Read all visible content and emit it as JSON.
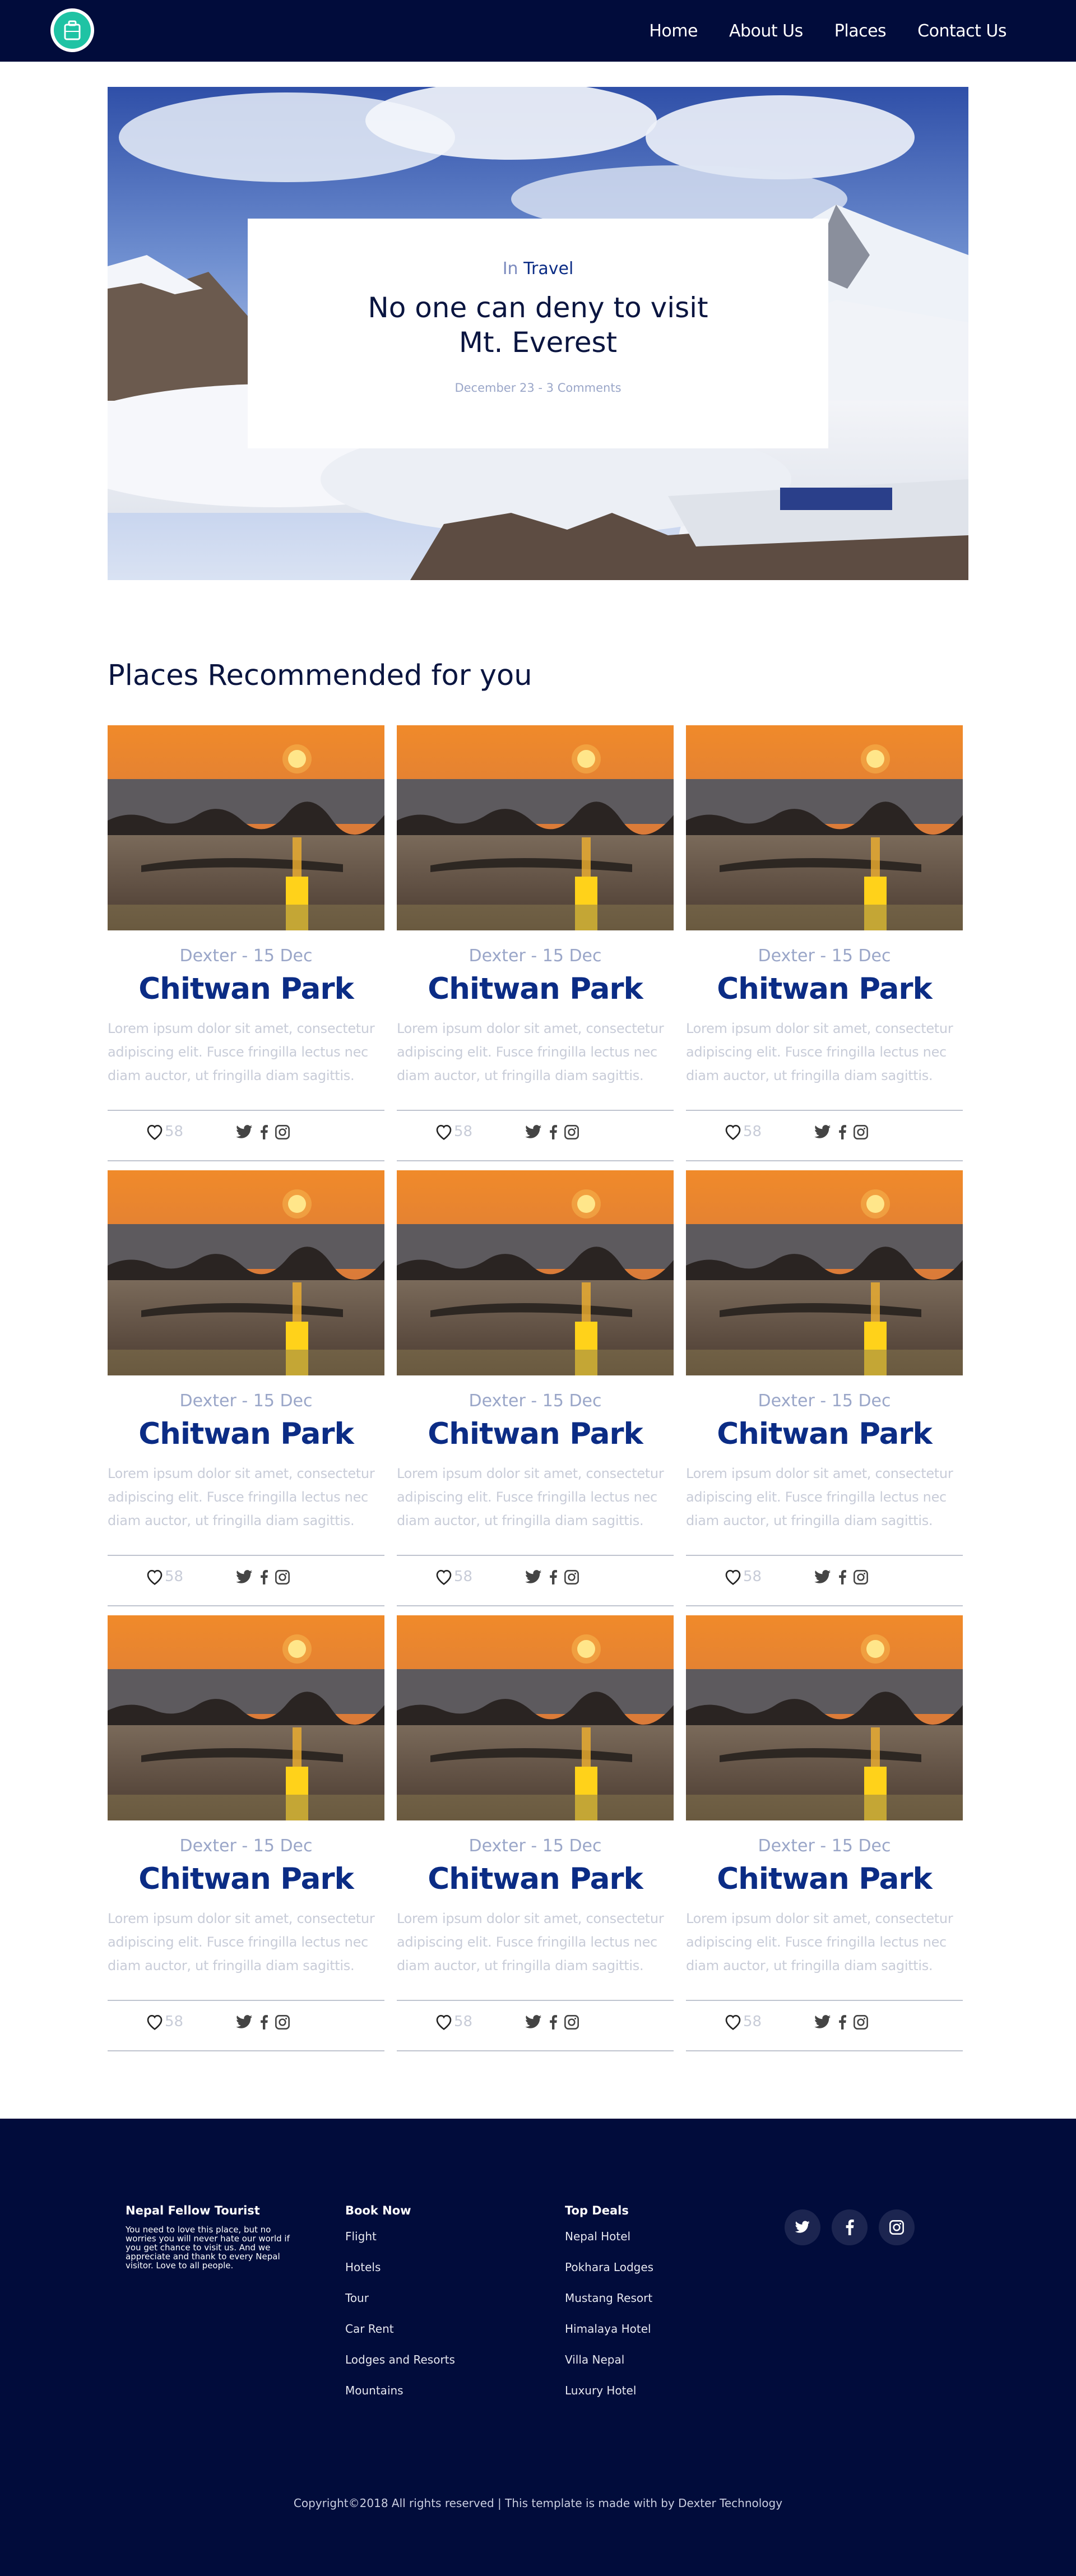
{
  "nav": {
    "links": [
      "Home",
      "About Us",
      "Places",
      "Contact Us"
    ]
  },
  "hero": {
    "category_prefix": "In",
    "category": "Travel",
    "title_line1": "No one can deny to visit",
    "title_line2": "Mt. Everest",
    "meta": "December 23 - 3 Comments"
  },
  "section": {
    "title": "Places Recommended for you"
  },
  "cards": [
    {
      "meta": "Dexter - 15 Dec",
      "title": "Chitwan Park",
      "desc": "Lorem ipsum dolor sit amet, consectetur adipiscing elit. Fusce fringilla lectus nec diam auctor, ut fringilla diam sagittis.",
      "likes": "58"
    },
    {
      "meta": "Dexter - 15 Dec",
      "title": "Chitwan Park",
      "desc": "Lorem ipsum dolor sit amet, consectetur adipiscing elit. Fusce fringilla lectus nec diam auctor, ut fringilla diam sagittis.",
      "likes": "58"
    },
    {
      "meta": "Dexter - 15 Dec",
      "title": "Chitwan Park",
      "desc": "Lorem ipsum dolor sit amet, consectetur adipiscing elit. Fusce fringilla lectus nec diam auctor, ut fringilla diam sagittis.",
      "likes": "58"
    },
    {
      "meta": "Dexter - 15 Dec",
      "title": "Chitwan Park",
      "desc": "Lorem ipsum dolor sit amet, consectetur adipiscing elit. Fusce fringilla lectus nec diam auctor, ut fringilla diam sagittis.",
      "likes": "58"
    },
    {
      "meta": "Dexter - 15 Dec",
      "title": "Chitwan Park",
      "desc": "Lorem ipsum dolor sit amet, consectetur adipiscing elit. Fusce fringilla lectus nec diam auctor, ut fringilla diam sagittis.",
      "likes": "58"
    },
    {
      "meta": "Dexter - 15 Dec",
      "title": "Chitwan Park",
      "desc": "Lorem ipsum dolor sit amet, consectetur adipiscing elit. Fusce fringilla lectus nec diam auctor, ut fringilla diam sagittis.",
      "likes": "58"
    },
    {
      "meta": "Dexter - 15 Dec",
      "title": "Chitwan Park",
      "desc": "Lorem ipsum dolor sit amet, consectetur adipiscing elit. Fusce fringilla lectus nec diam auctor, ut fringilla diam sagittis.",
      "likes": "58"
    },
    {
      "meta": "Dexter - 15 Dec",
      "title": "Chitwan Park",
      "desc": "Lorem ipsum dolor sit amet, consectetur adipiscing elit. Fusce fringilla lectus nec diam auctor, ut fringilla diam sagittis.",
      "likes": "58"
    },
    {
      "meta": "Dexter - 15 Dec",
      "title": "Chitwan Park",
      "desc": "Lorem ipsum dolor sit amet, consectetur adipiscing elit. Fusce fringilla lectus nec diam auctor, ut fringilla diam sagittis.",
      "likes": "58"
    }
  ],
  "footer": {
    "about_title": "Nepal Fellow Tourist",
    "about_text": "You need to love this place, but no worries you will never hate our world if you get chance to visit us. And we appreciate and thank to every Nepal visitor. Love to all people.",
    "book_title": "Book Now",
    "book_items": [
      "Flight",
      "Hotels",
      "Tour",
      "Car Rent",
      "Lodges and Resorts",
      "Mountains"
    ],
    "deals_title": "Top Deals",
    "deals_items": [
      "Nepal Hotel",
      "Pokhara Lodges",
      "Mustang Resort",
      "Himalaya Hotel",
      "Villa Nepal",
      "Luxury Hotel"
    ],
    "social_icons": [
      "twitter-icon",
      "facebook-icon",
      "instagram-icon"
    ],
    "copyright": "Copyright©2018 All rights reserved | This template is made with by Dexter Technology"
  },
  "colors": {
    "nav_bg": "#010c3b",
    "accent": "#0b2c85",
    "logo": "#1fc3a4"
  }
}
